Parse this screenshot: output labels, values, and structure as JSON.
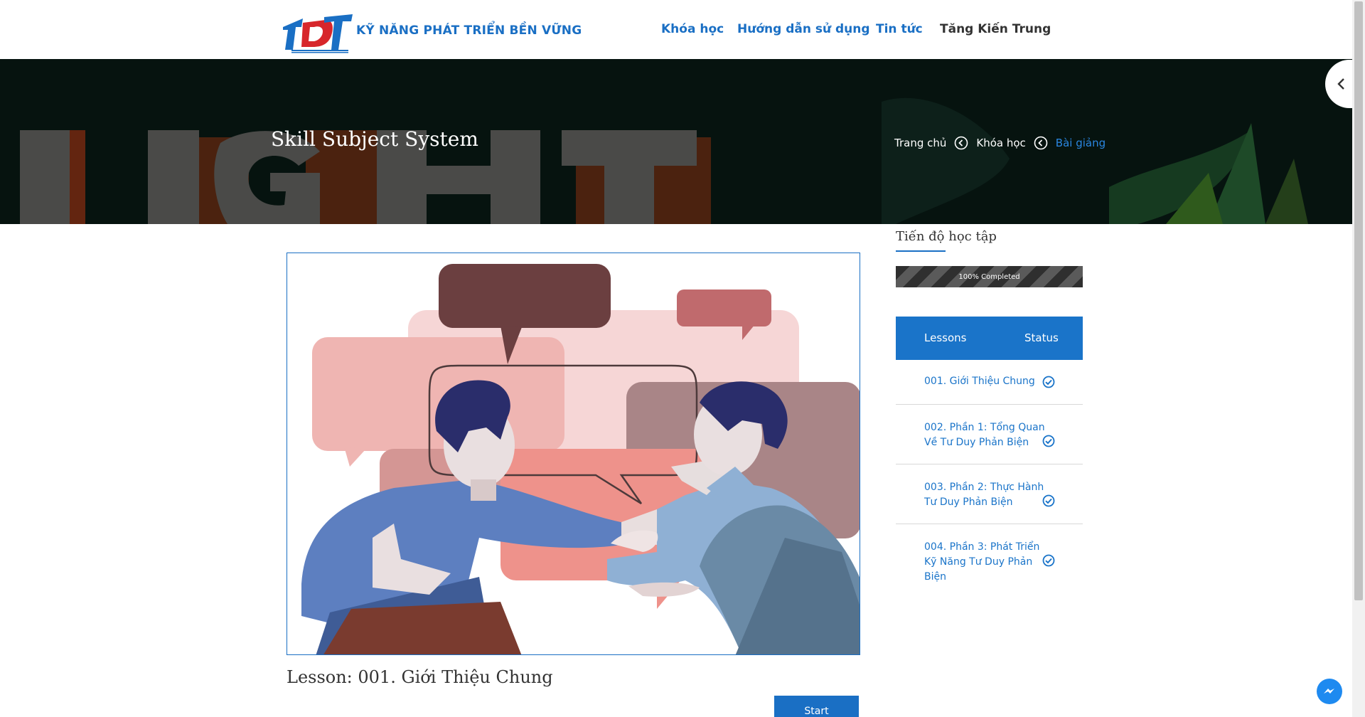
{
  "header": {
    "brand": "KỸ NĂNG PHÁT TRIỂN BỀN VỮNG",
    "nav": [
      "Khóa học",
      "Hướng dẫn sử dụng",
      "Tin tức"
    ],
    "user_name": "Tăng Kiến Trung"
  },
  "hero": {
    "title": "Skill Subject System",
    "breadcrumbs": [
      "Trang chủ",
      "Khóa học",
      "Bài giảng"
    ]
  },
  "lesson": {
    "title": "Lesson: 001. Giới Thiệu Chung",
    "start_label": "Start"
  },
  "progress": {
    "title": "Tiến độ học tập",
    "percent": 100,
    "label": "100% Completed"
  },
  "lessons_table": {
    "header_lessons": "Lessons",
    "header_status": "Status",
    "rows": [
      {
        "name": "001. Giới Thiệu Chung",
        "status": "completed"
      },
      {
        "name": "002. Phần 1: Tổng Quan Về Tư Duy Phản Biện",
        "status": "completed"
      },
      {
        "name": "003. Phần 2: Thực Hành Tư Duy Phản Biện",
        "status": "completed"
      },
      {
        "name": "004. Phần 3: Phát Triển Kỹ Năng Tư Duy Phản Biện",
        "status": "completed"
      }
    ]
  },
  "colors": {
    "brand_blue": "#1a6fc4",
    "hero_bg": "#06130f",
    "messenger": "#1e8af0"
  },
  "icons": [
    "logo",
    "chevron-left-icon",
    "breadcrumb-separator-icon",
    "check-circle-icon",
    "messenger-icon"
  ]
}
